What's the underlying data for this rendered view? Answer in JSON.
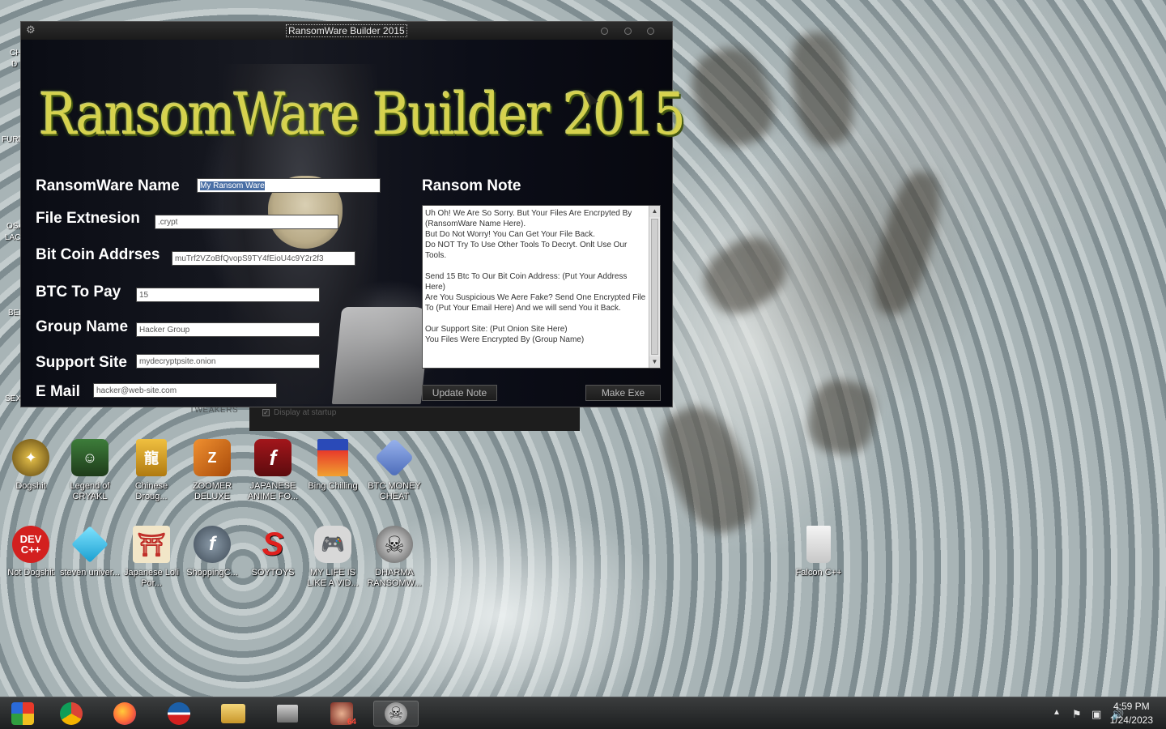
{
  "app_window": {
    "title": "RansomWare Builder 2015",
    "logo_text": "RansomWare Builder 2015",
    "fields": [
      {
        "label": "RansomWare Name",
        "value": "My Ransom Ware"
      },
      {
        "label": "File Extnesion",
        "value": ".crypt"
      },
      {
        "label": "Bit Coin Addrses",
        "value": "muTrf2VZoBfQvopS9TY4fEioU4c9Y2r2f3"
      },
      {
        "label": "BTC To Pay",
        "value": "15"
      },
      {
        "label": "Group Name",
        "value": "Hacker Group"
      },
      {
        "label": "Support Site",
        "value": "mydecryptpsite.onion"
      },
      {
        "label": "E Mail",
        "value": "hacker@web-site.com"
      }
    ],
    "ransom_note_label": "Ransom Note",
    "ransom_note_text": "Uh Oh! We Are So Sorry. But Your Files Are Encrpyted By (RansomWare Name Here).\nBut Do Not Worry! You Can Get Your File Back.\nDo NOT Try To Use Other Tools To Decryt. Onlt Use Our Tools.\n\nSend 15 Btc To Our Bit Coin Address: (Put Your Address Here)\nAre You Suspicious We Aere Fake? Send One Encrypted File To (Put Your Email Here) And we will send You it Back.\n\nOur Support Site: (Put Onion Site Here)\nYou Files Were Encrypted By (Group Name)",
    "update_note_button": "Update Note",
    "make_exe_button": "Make Exe"
  },
  "background_window": {
    "checkbox_label": "Display at startup",
    "tweakers_text": "TWEAKERS"
  },
  "desktop_icons": [
    {
      "label": "Dogshit",
      "icon": "dogshit-icon",
      "color": "#c9a227"
    },
    {
      "label": "Legend of CRYAKL",
      "icon": "pixel-character-icon",
      "color": "#4a8f3a"
    },
    {
      "label": "Chinese Droug...",
      "icon": "chinese-dragon-icon",
      "color": "#e0b030"
    },
    {
      "label": "ZOOMER DELUXE",
      "icon": "zoomer-icon",
      "color": "#e07a1a"
    },
    {
      "label": "JAPANESE ANIME FO...",
      "icon": "flash-icon",
      "color": "#8e1216"
    },
    {
      "label": "Bing Chilling",
      "icon": "bing-chilling-icon",
      "color": "#c83a2a"
    },
    {
      "label": "BTC MONEY CHEAT",
      "icon": "btc-cheat-icon",
      "color": "#6c8fd6"
    },
    {
      "label": "Not Dogshit",
      "icon": "dev-cpp-icon",
      "color": "#d3201f"
    },
    {
      "label": "steven univer...",
      "icon": "gem-icon",
      "color": "#29b9e8"
    },
    {
      "label": "Japanese Loli Por...",
      "icon": "torii-icon",
      "color": "#c0302a"
    },
    {
      "label": "ShoppingC...",
      "icon": "flash-player-icon",
      "color": "#5a6a78"
    },
    {
      "label": "SOYTOYS",
      "icon": "soytoys-icon",
      "color": "#e0201e"
    },
    {
      "label": "MY LIFE IS LIKE A VID...",
      "icon": "gamepad-icon",
      "color": "#d8d8d8"
    },
    {
      "label": "DHARMA RANSOMW...",
      "icon": "skull-icon",
      "color": "#2b2b2b"
    },
    {
      "label": "Falcon C++",
      "icon": "recycle-bin-icon",
      "color": "#eaeaea"
    }
  ],
  "desktop_peek_labels": [
    "CH",
    "D",
    "FURI",
    "OSA",
    "LAC",
    "BEL",
    "SEX"
  ],
  "taskbar": {
    "apps": [
      {
        "name": "start-orb-icon",
        "color": "#2f8f2f"
      },
      {
        "name": "chrome-icon",
        "color": "#db4437"
      },
      {
        "name": "firefox-icon",
        "color": "#ff7139"
      },
      {
        "name": "obama-logo-icon",
        "color": "#1c5fa8"
      },
      {
        "name": "file-explorer-icon",
        "color": "#e8c25a"
      },
      {
        "name": "archive-icon",
        "color": "#9a9a9a"
      },
      {
        "name": "anime-app-icon",
        "color": "#b0463a"
      },
      {
        "name": "skull-app-icon",
        "color": "#dddddd"
      }
    ],
    "badge": "64",
    "time": "4:59 PM",
    "date": "1/24/2023"
  }
}
